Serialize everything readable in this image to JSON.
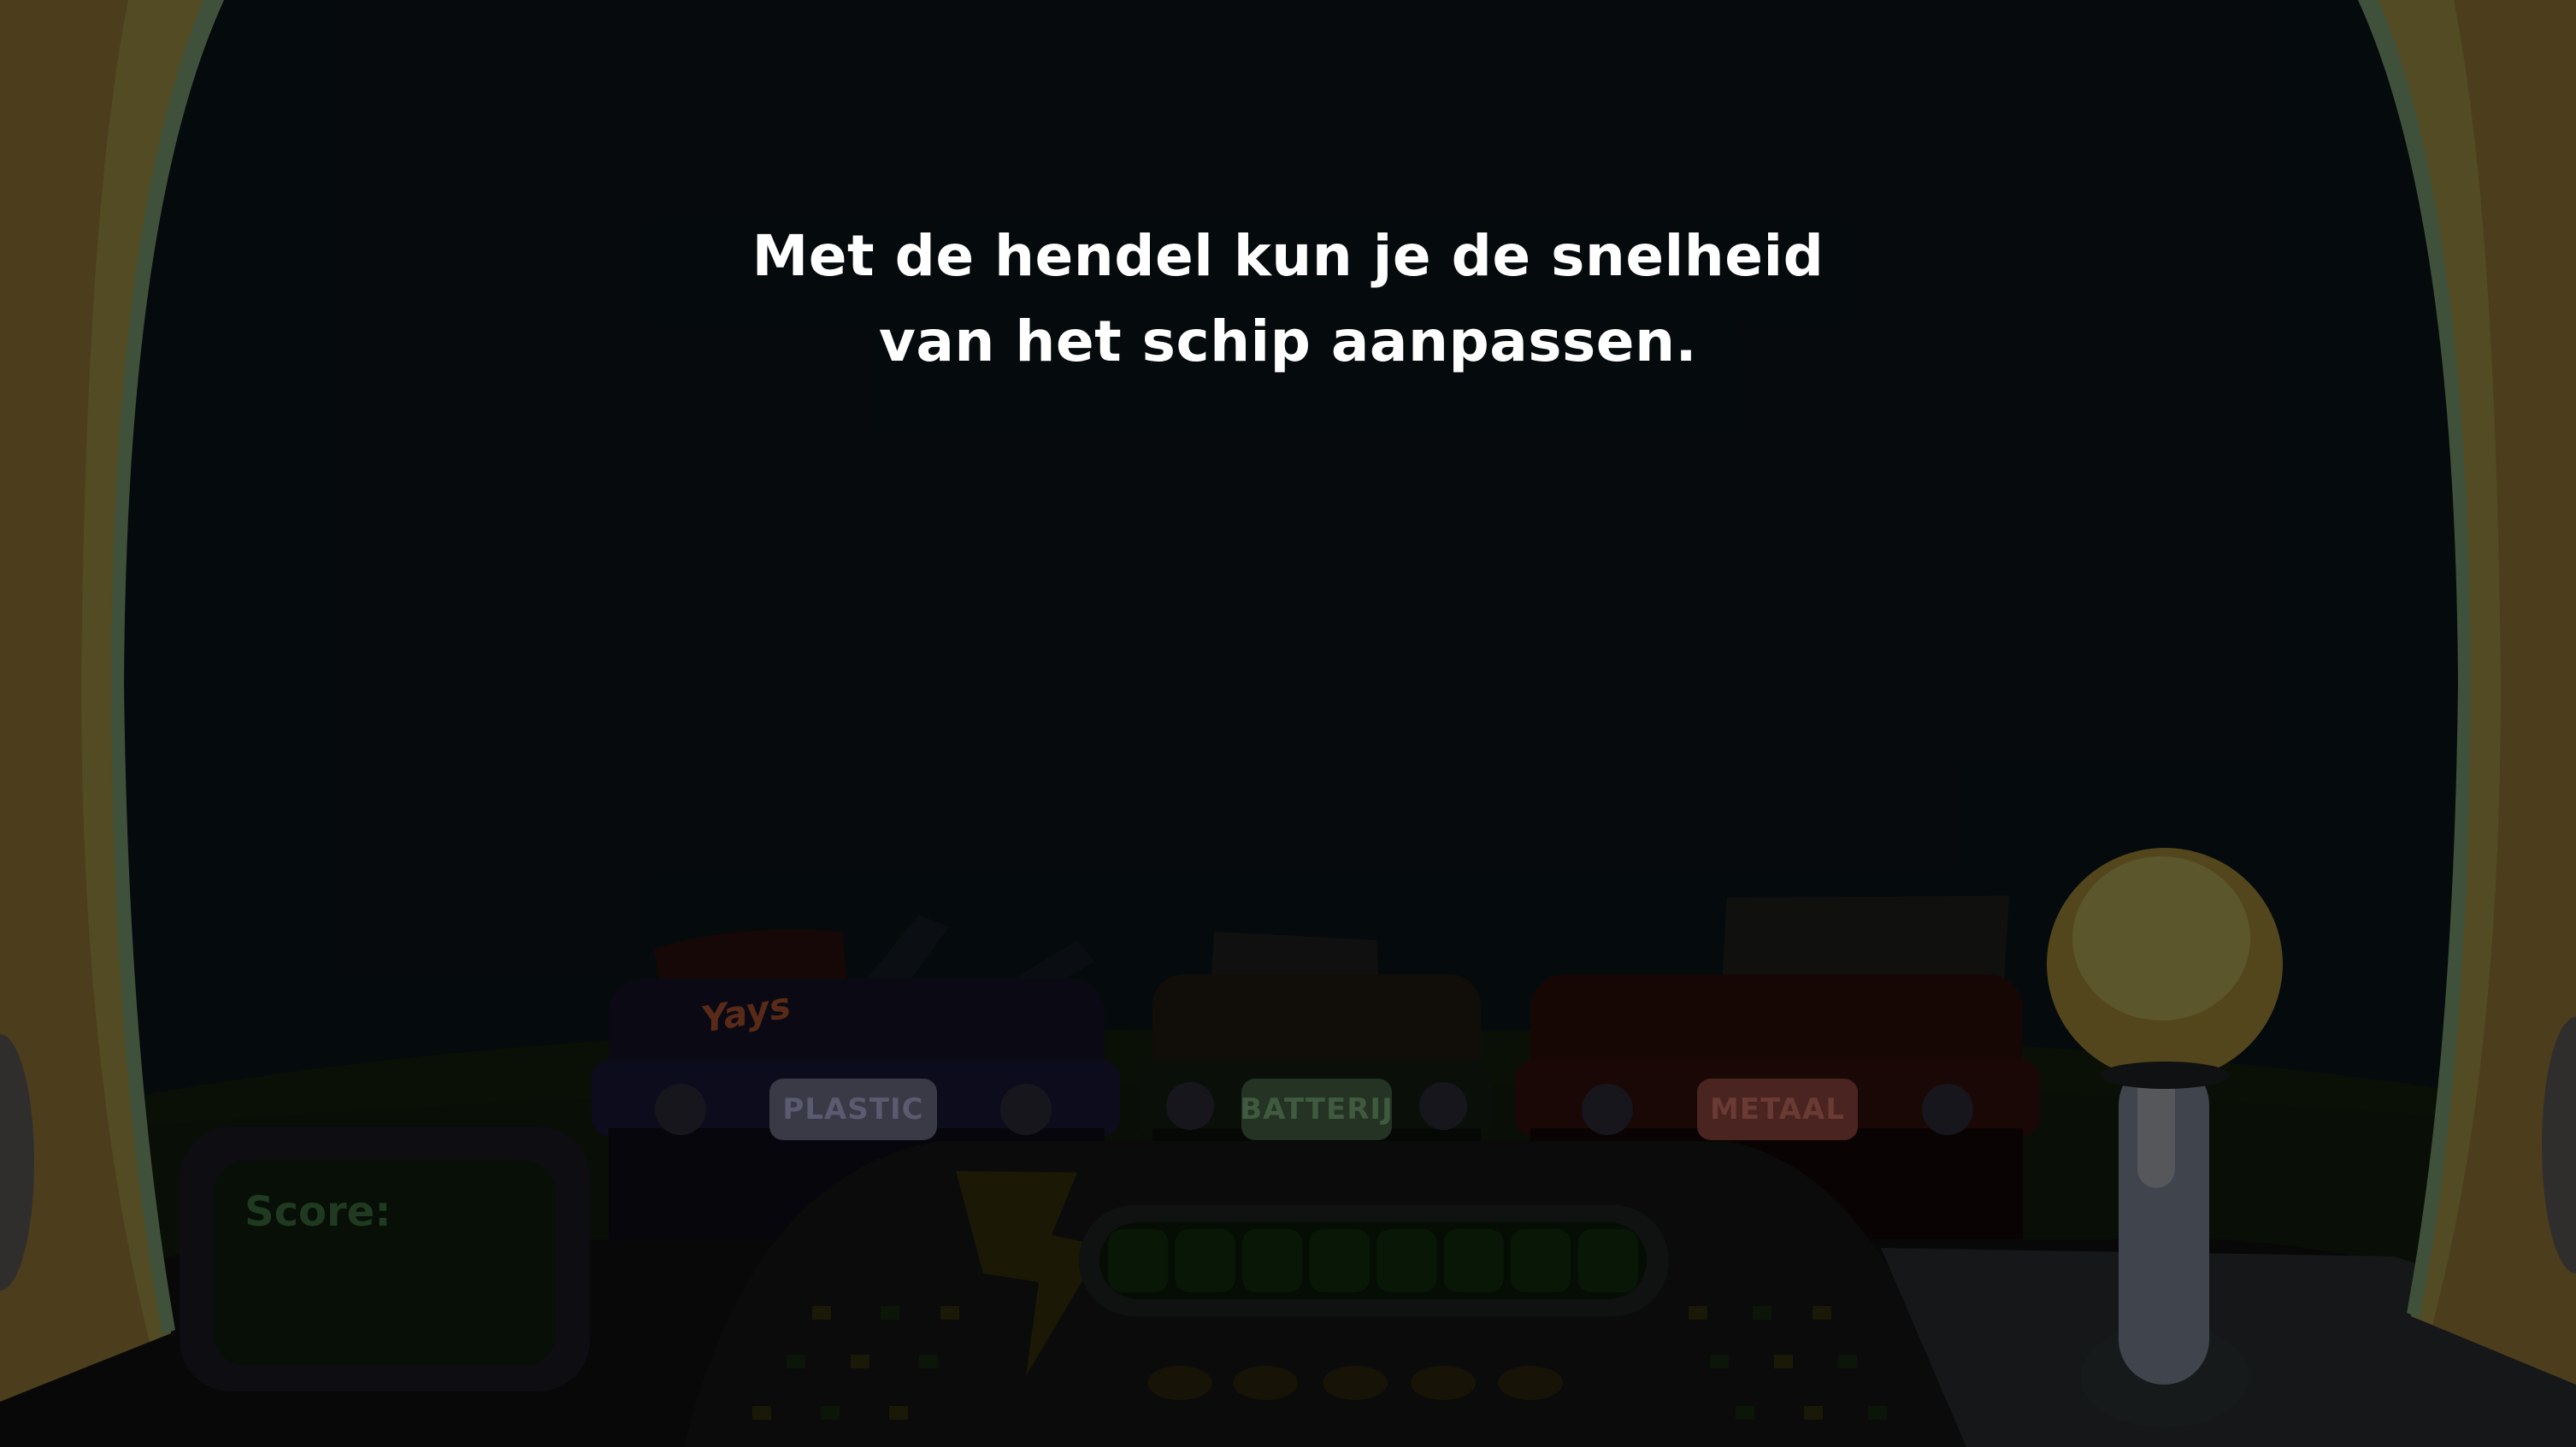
{
  "tutorial": {
    "line1": "Met de hendel kun je de snelheid",
    "line2": "van het schip aanpassen."
  },
  "bins": [
    {
      "label": "PLASTIC",
      "color": "#2d2a4f"
    },
    {
      "label": "BATTERIJ",
      "color": "#3a3320"
    },
    {
      "label": "METAAL",
      "color": "#4a1a14"
    }
  ],
  "score": {
    "label": "Score:"
  },
  "items": {
    "chips_brand": "Yays"
  },
  "energy": {
    "segments_filled": 8,
    "segments_total": 8
  },
  "colors": {
    "frame": "#d2a94c",
    "frame_inner": "#c0d06a",
    "sky": "#0f1b20",
    "lever_knob": "#f2e274",
    "overlay": "rgba(0,0,0,0.72)"
  }
}
